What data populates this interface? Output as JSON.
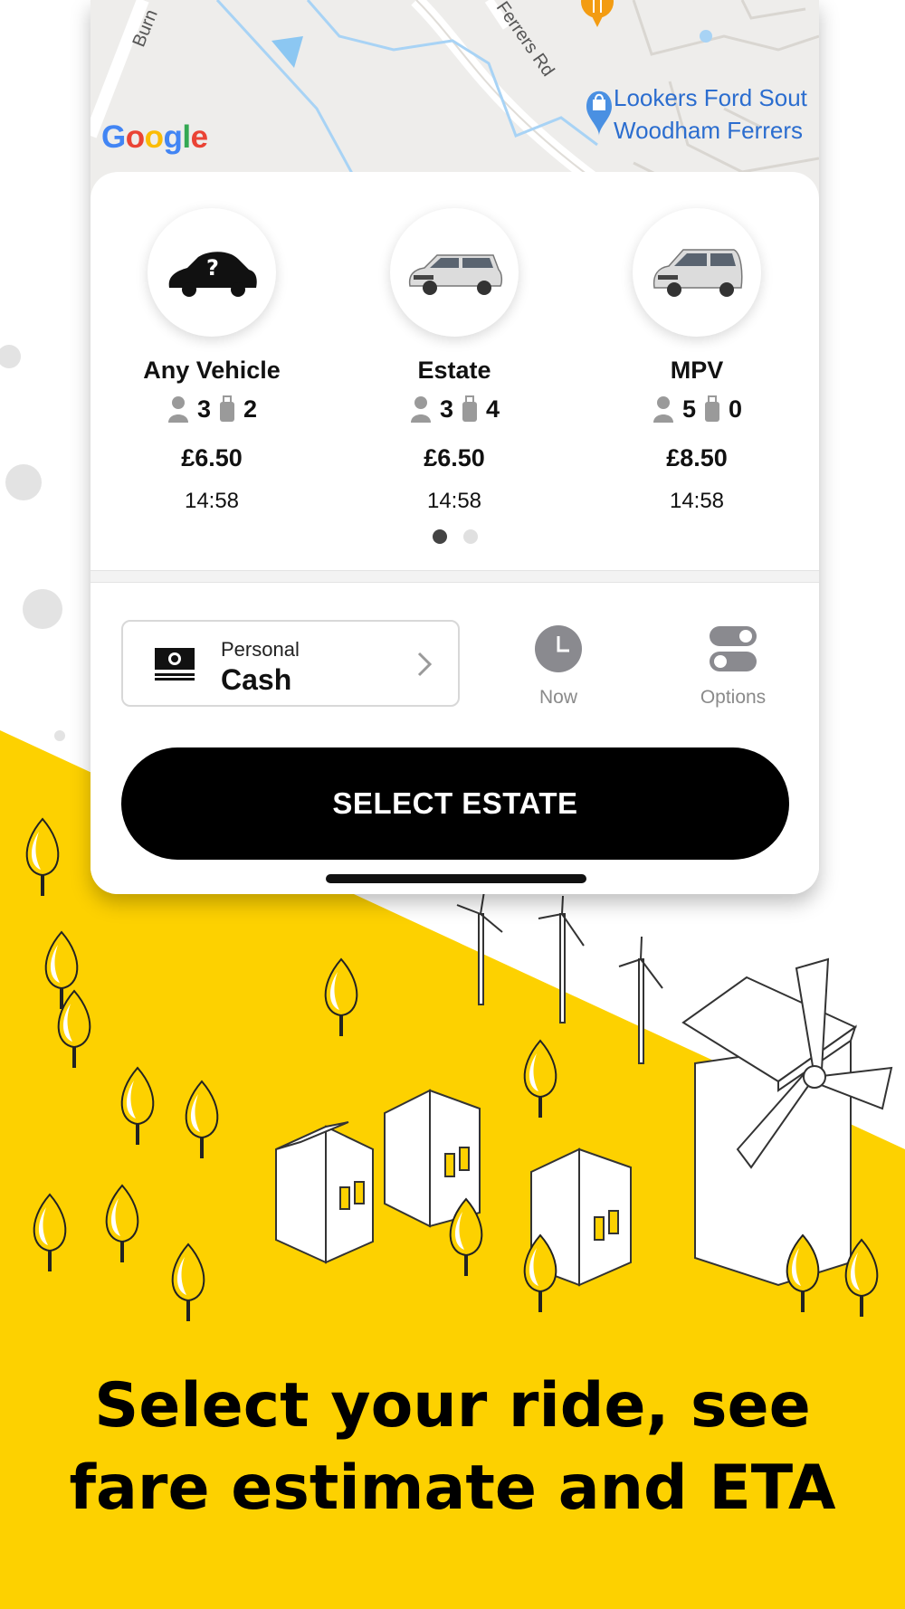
{
  "map": {
    "provider_logo": "Google",
    "road_labels": [
      "Burn",
      "Ferrers Rd"
    ],
    "poi": {
      "line1": "Lookers Ford Sout",
      "line2": "Woodham Ferrers",
      "icon": "shopping-bag-pin-icon"
    },
    "restaurant_icon": "fork-knife-pin-icon"
  },
  "vehicles": [
    {
      "name": "Any Vehicle",
      "passengers": "3",
      "luggage": "2",
      "price": "£6.50",
      "eta": "14:58",
      "icon": "unknown-car-icon"
    },
    {
      "name": "Estate",
      "passengers": "3",
      "luggage": "4",
      "price": "£6.50",
      "eta": "14:58",
      "icon": "estate-car-icon"
    },
    {
      "name": "MPV",
      "passengers": "5",
      "luggage": "0",
      "price": "£8.50",
      "eta": "14:58",
      "icon": "mpv-car-icon"
    }
  ],
  "pager": {
    "pages": 2,
    "current": 1
  },
  "payment": {
    "type": "Personal",
    "method": "Cash",
    "icon": "cash-icon"
  },
  "controls": {
    "time_label": "Now",
    "options_label": "Options"
  },
  "select_button": "SELECT ESTATE",
  "headline": {
    "line1": "Select your ride, see",
    "line2": "fare estimate and ETA"
  },
  "colors": {
    "accent_yellow": "#FDD100",
    "button_black": "#000000",
    "map_blue": "#2b6dcf"
  }
}
